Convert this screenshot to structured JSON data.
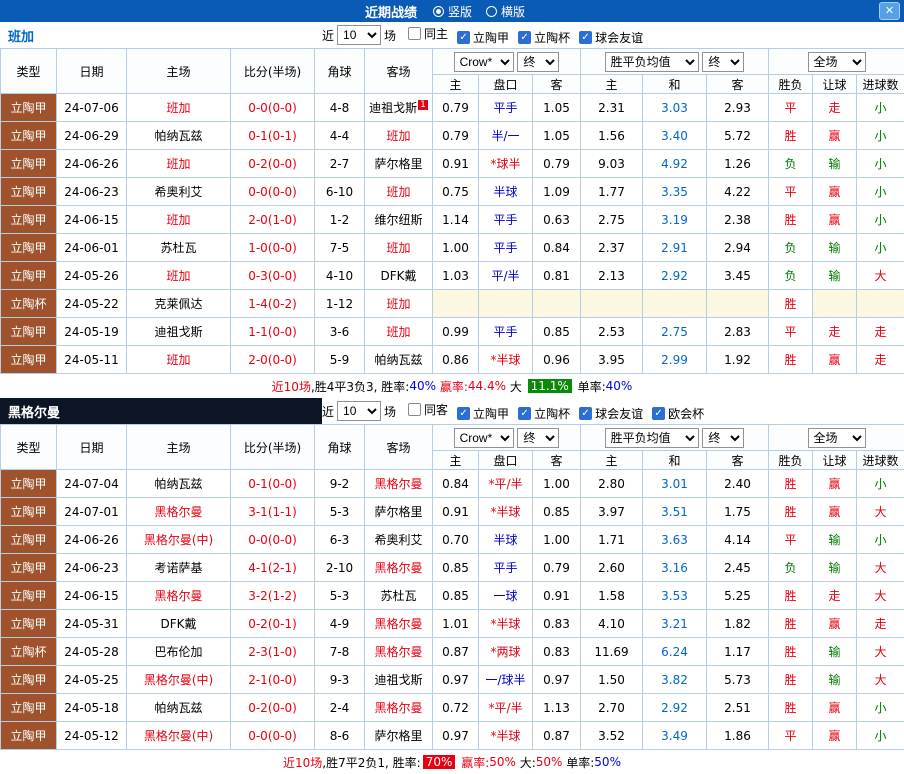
{
  "titlebar": {
    "title": "近期战绩",
    "vertical": "竖版",
    "horizontal": "横版",
    "close_glyph": "✕"
  },
  "sections": [
    {
      "team": "班加",
      "filter": {
        "near": "近",
        "count": "10",
        "games": "场",
        "checkboxes": [
          {
            "label": "同主",
            "checked": false
          },
          {
            "label": "立陶甲",
            "checked": true
          },
          {
            "label": "立陶杯",
            "checked": true
          },
          {
            "label": "球会友谊",
            "checked": true
          }
        ]
      },
      "selects": {
        "company": "Crow*",
        "final_a": "终",
        "avg": "胜平负均值",
        "final_b": "终",
        "scope": "全场"
      },
      "headers": {
        "type": "类型",
        "date": "日期",
        "home": "主场",
        "score": "比分(半场)",
        "corner": "角球",
        "away": "客场",
        "sub": [
          "主",
          "盘口",
          "客",
          "主",
          "和",
          "客",
          "胜负",
          "让球",
          "进球数"
        ]
      },
      "rows": [
        {
          "type": "立陶甲",
          "date": "24-07-06",
          "home": "班加",
          "home_focus": true,
          "score": "0-0(0-0)",
          "corner": "4-8",
          "away": "迪祖戈斯",
          "away_focus": false,
          "away_badge": "1",
          "o1": "0.79",
          "hc": "平手",
          "o2": "1.05",
          "a1": "2.31",
          "a2": "3.03",
          "a3": "2.93",
          "res": [
            [
              "平",
              "r"
            ],
            [
              "走",
              "r"
            ],
            [
              "小",
              "g"
            ]
          ]
        },
        {
          "type": "立陶甲",
          "date": "24-06-29",
          "home": "帕纳瓦兹",
          "home_focus": false,
          "score": "0-1(0-1)",
          "corner": "4-4",
          "away": "班加",
          "away_focus": true,
          "o1": "0.79",
          "hc": "半/一",
          "o2": "1.05",
          "a1": "1.56",
          "a2": "3.40",
          "a3": "5.72",
          "res": [
            [
              "胜",
              "r"
            ],
            [
              "赢",
              "r"
            ],
            [
              "小",
              "g"
            ]
          ]
        },
        {
          "type": "立陶甲",
          "date": "24-06-26",
          "home": "班加",
          "home_focus": true,
          "score": "0-2(0-0)",
          "corner": "2-7",
          "away": "萨尔格里",
          "away_focus": false,
          "o1": "0.91",
          "hc": "*球半",
          "o2": "0.79",
          "a1": "9.03",
          "a2": "4.92",
          "a3": "1.26",
          "res": [
            [
              "负",
              "g"
            ],
            [
              "输",
              "g"
            ],
            [
              "小",
              "g"
            ]
          ]
        },
        {
          "type": "立陶甲",
          "date": "24-06-23",
          "home": "希奥利艾",
          "home_focus": false,
          "score": "0-0(0-0)",
          "corner": "6-10",
          "away": "班加",
          "away_focus": true,
          "o1": "0.75",
          "hc": "半球",
          "o2": "1.09",
          "a1": "1.77",
          "a2": "3.35",
          "a3": "4.22",
          "res": [
            [
              "平",
              "r"
            ],
            [
              "赢",
              "r"
            ],
            [
              "小",
              "g"
            ]
          ]
        },
        {
          "type": "立陶甲",
          "date": "24-06-15",
          "home": "班加",
          "home_focus": true,
          "score": "2-0(1-0)",
          "corner": "1-2",
          "away": "维尔纽斯",
          "away_focus": false,
          "o1": "1.14",
          "hc": "平手",
          "o2": "0.63",
          "a1": "2.75",
          "a2": "3.19",
          "a3": "2.38",
          "res": [
            [
              "胜",
              "r"
            ],
            [
              "赢",
              "r"
            ],
            [
              "小",
              "g"
            ]
          ]
        },
        {
          "type": "立陶甲",
          "date": "24-06-01",
          "home": "苏杜瓦",
          "home_focus": false,
          "score": "1-0(0-0)",
          "corner": "7-5",
          "away": "班加",
          "away_focus": true,
          "o1": "1.00",
          "hc": "平手",
          "o2": "0.84",
          "a1": "2.37",
          "a2": "2.91",
          "a3": "2.94",
          "res": [
            [
              "负",
              "g"
            ],
            [
              "输",
              "g"
            ],
            [
              "小",
              "g"
            ]
          ]
        },
        {
          "type": "立陶甲",
          "date": "24-05-26",
          "home": "班加",
          "home_focus": true,
          "score": "0-3(0-0)",
          "corner": "4-10",
          "away": "DFK戴",
          "away_focus": false,
          "o1": "1.03",
          "hc": "平/半",
          "o2": "0.81",
          "a1": "2.13",
          "a2": "2.92",
          "a3": "3.45",
          "res": [
            [
              "负",
              "g"
            ],
            [
              "输",
              "g"
            ],
            [
              "大",
              "r"
            ]
          ]
        },
        {
          "type": "立陶杯",
          "date": "24-05-22",
          "home": "克莱佩达",
          "home_focus": false,
          "score": "1-4(0-2)",
          "corner": "1-12",
          "away": "班加",
          "away_focus": true,
          "o1": "",
          "hc": "",
          "o2": "",
          "a1": "",
          "a2": "",
          "a3": "",
          "res": [
            [
              "胜",
              "r"
            ],
            [
              "",
              ""
            ],
            [
              "",
              ""
            ]
          ]
        },
        {
          "type": "立陶甲",
          "date": "24-05-19",
          "home": "迪祖戈斯",
          "home_focus": false,
          "score": "1-1(0-0)",
          "corner": "3-6",
          "away": "班加",
          "away_focus": true,
          "o1": "0.99",
          "hc": "平手",
          "o2": "0.85",
          "a1": "2.53",
          "a2": "2.75",
          "a3": "2.83",
          "res": [
            [
              "平",
              "r"
            ],
            [
              "走",
              "r"
            ],
            [
              "走",
              "r"
            ]
          ]
        },
        {
          "type": "立陶甲",
          "date": "24-05-11",
          "home": "班加",
          "home_focus": true,
          "score": "2-0(0-0)",
          "corner": "5-9",
          "away": "帕纳瓦兹",
          "away_focus": false,
          "o1": "0.86",
          "hc": "*半球",
          "o2": "0.96",
          "a1": "3.95",
          "a2": "2.99",
          "a3": "1.92",
          "res": [
            [
              "胜",
              "r"
            ],
            [
              "赢",
              "r"
            ],
            [
              "走",
              "r"
            ]
          ]
        }
      ],
      "summary": [
        {
          "t": "近10场",
          "c": "red"
        },
        {
          "t": ",胜4平3负3, 胜率:",
          "c": ""
        },
        {
          "t": "40%",
          "c": "blue"
        },
        {
          "t": " 赢率:",
          "c": "red"
        },
        {
          "t": "44.4%",
          "c": "red"
        },
        {
          "t": " 大 ",
          "c": ""
        },
        {
          "t": "11.1%",
          "c": "hlg"
        },
        {
          "t": " 单率:",
          "c": ""
        },
        {
          "t": "40%",
          "c": "blue"
        }
      ]
    },
    {
      "team": "黑格尔曼",
      "filter": {
        "near": "近",
        "count": "10",
        "games": "场",
        "checkboxes": [
          {
            "label": "同客",
            "checked": false
          },
          {
            "label": "立陶甲",
            "checked": true
          },
          {
            "label": "立陶杯",
            "checked": true
          },
          {
            "label": "球会友谊",
            "checked": true
          },
          {
            "label": "欧会杯",
            "checked": true
          }
        ]
      },
      "selects": {
        "company": "Crow*",
        "final_a": "终",
        "avg": "胜平负均值",
        "final_b": "终",
        "scope": "全场"
      },
      "headers": {
        "type": "类型",
        "date": "日期",
        "home": "主场",
        "score": "比分(半场)",
        "corner": "角球",
        "away": "客场",
        "sub": [
          "主",
          "盘口",
          "客",
          "主",
          "和",
          "客",
          "胜负",
          "让球",
          "进球数"
        ]
      },
      "rows": [
        {
          "type": "立陶甲",
          "date": "24-07-04",
          "home": "帕纳瓦兹",
          "home_focus": false,
          "score": "0-1(0-0)",
          "corner": "9-2",
          "away": "黑格尔曼",
          "away_focus": true,
          "o1": "0.84",
          "hc": "*平/半",
          "o2": "1.00",
          "a1": "2.80",
          "a2": "3.01",
          "a3": "2.40",
          "res": [
            [
              "胜",
              "r"
            ],
            [
              "赢",
              "r"
            ],
            [
              "小",
              "g"
            ]
          ]
        },
        {
          "type": "立陶甲",
          "date": "24-07-01",
          "home": "黑格尔曼",
          "home_focus": true,
          "score": "3-1(1-1)",
          "corner": "5-3",
          "away": "萨尔格里",
          "away_focus": false,
          "o1": "0.91",
          "hc": "*半球",
          "o2": "0.85",
          "a1": "3.97",
          "a2": "3.51",
          "a3": "1.75",
          "res": [
            [
              "胜",
              "r"
            ],
            [
              "赢",
              "r"
            ],
            [
              "大",
              "r"
            ]
          ]
        },
        {
          "type": "立陶甲",
          "date": "24-06-26",
          "home": "黑格尔曼(中)",
          "home_focus": true,
          "score": "0-0(0-0)",
          "corner": "6-3",
          "away": "希奥利艾",
          "away_focus": false,
          "o1": "0.70",
          "hc": "半球",
          "o2": "1.00",
          "a1": "1.71",
          "a2": "3.63",
          "a3": "4.14",
          "res": [
            [
              "平",
              "r"
            ],
            [
              "输",
              "g"
            ],
            [
              "小",
              "g"
            ]
          ]
        },
        {
          "type": "立陶甲",
          "date": "24-06-23",
          "home": "考诺萨基",
          "home_focus": false,
          "score": "4-1(2-1)",
          "corner": "2-10",
          "away": "黑格尔曼",
          "away_focus": true,
          "o1": "0.85",
          "hc": "平手",
          "o2": "0.79",
          "a1": "2.60",
          "a2": "3.16",
          "a3": "2.45",
          "res": [
            [
              "负",
              "g"
            ],
            [
              "输",
              "g"
            ],
            [
              "大",
              "r"
            ]
          ]
        },
        {
          "type": "立陶甲",
          "date": "24-06-15",
          "home": "黑格尔曼",
          "home_focus": true,
          "score": "3-2(1-2)",
          "corner": "5-3",
          "away": "苏杜瓦",
          "away_focus": false,
          "o1": "0.85",
          "hc": "一球",
          "o2": "0.91",
          "a1": "1.58",
          "a2": "3.53",
          "a3": "5.25",
          "res": [
            [
              "胜",
              "r"
            ],
            [
              "走",
              "r"
            ],
            [
              "大",
              "r"
            ]
          ]
        },
        {
          "type": "立陶甲",
          "date": "24-05-31",
          "home": "DFK戴",
          "home_focus": false,
          "score": "0-2(0-1)",
          "corner": "4-9",
          "away": "黑格尔曼",
          "away_focus": true,
          "o1": "1.01",
          "hc": "*半球",
          "o2": "0.83",
          "a1": "4.10",
          "a2": "3.21",
          "a3": "1.82",
          "res": [
            [
              "胜",
              "r"
            ],
            [
              "赢",
              "r"
            ],
            [
              "走",
              "r"
            ]
          ]
        },
        {
          "type": "立陶杯",
          "date": "24-05-28",
          "home": "巴布伦加",
          "home_focus": false,
          "score": "2-3(1-0)",
          "corner": "7-8",
          "away": "黑格尔曼",
          "away_focus": true,
          "o1": "0.87",
          "hc": "*两球",
          "o2": "0.83",
          "a1": "11.69",
          "a2": "6.24",
          "a3": "1.17",
          "res": [
            [
              "胜",
              "r"
            ],
            [
              "输",
              "g"
            ],
            [
              "大",
              "r"
            ]
          ]
        },
        {
          "type": "立陶甲",
          "date": "24-05-25",
          "home": "黑格尔曼(中)",
          "home_focus": true,
          "score": "2-1(0-0)",
          "corner": "9-3",
          "away": "迪祖戈斯",
          "away_focus": false,
          "o1": "0.97",
          "hc": "一/球半",
          "o2": "0.97",
          "a1": "1.50",
          "a2": "3.82",
          "a3": "5.73",
          "res": [
            [
              "胜",
              "r"
            ],
            [
              "输",
              "g"
            ],
            [
              "大",
              "r"
            ]
          ]
        },
        {
          "type": "立陶甲",
          "date": "24-05-18",
          "home": "帕纳瓦兹",
          "home_focus": false,
          "score": "0-2(0-0)",
          "corner": "2-4",
          "away": "黑格尔曼",
          "away_focus": true,
          "o1": "0.72",
          "hc": "*平/半",
          "o2": "1.13",
          "a1": "2.70",
          "a2": "2.92",
          "a3": "2.51",
          "res": [
            [
              "胜",
              "r"
            ],
            [
              "赢",
              "r"
            ],
            [
              "小",
              "g"
            ]
          ]
        },
        {
          "type": "立陶甲",
          "date": "24-05-12",
          "home": "黑格尔曼(中)",
          "home_focus": true,
          "score": "0-0(0-0)",
          "corner": "8-6",
          "away": "萨尔格里",
          "away_focus": false,
          "o1": "0.97",
          "hc": "*半球",
          "o2": "0.87",
          "a1": "3.52",
          "a2": "3.49",
          "a3": "1.86",
          "res": [
            [
              "平",
              "r"
            ],
            [
              "赢",
              "r"
            ],
            [
              "小",
              "g"
            ]
          ]
        }
      ],
      "summary": [
        {
          "t": "近10场",
          "c": "red"
        },
        {
          "t": ",胜7平2负1, 胜率:",
          "c": ""
        },
        {
          "t": "70%",
          "c": "hlr"
        },
        {
          "t": " 赢率:",
          "c": "red"
        },
        {
          "t": "50%",
          "c": "red"
        },
        {
          "t": " 大:",
          "c": ""
        },
        {
          "t": "50%",
          "c": "red"
        },
        {
          "t": " 单率:",
          "c": ""
        },
        {
          "t": "50%",
          "c": "blue"
        }
      ]
    }
  ]
}
